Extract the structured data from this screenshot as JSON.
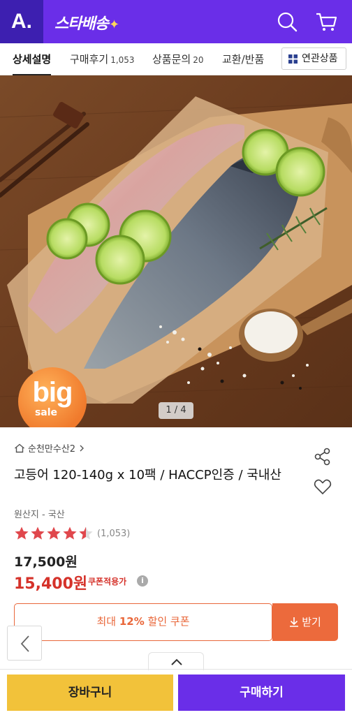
{
  "header": {
    "logo_letter": "A.",
    "brand": "스타배송",
    "brand_star": "✦",
    "colors": {
      "primary": "#6a2ee8",
      "logo_bg": "#3d1fb0"
    }
  },
  "tabs": [
    {
      "label": "상세설명",
      "count": "",
      "active": true
    },
    {
      "label": "구매후기",
      "count": "1,053",
      "active": false
    },
    {
      "label": "상품문의",
      "count": "20",
      "active": false
    },
    {
      "label": "교환/반품",
      "count": "",
      "active": false
    }
  ],
  "related_button": {
    "label": "연관상품",
    "icon": "grid-icon"
  },
  "gallery": {
    "pager": "1 / 4",
    "badge_big": "big",
    "badge_sale": "sale"
  },
  "product": {
    "store": "순천만수산2",
    "title": "고등어 120-140g x 10팩 / HACCP인증 / 국내산",
    "origin": "원산지 - 국산",
    "rating_value": 4.5,
    "rating_count": "(1,053)",
    "original_price": "17,500원",
    "sale_price": "15,400원",
    "coupon_applied_label": "쿠폰적용가",
    "info_icon": "i"
  },
  "coupon": {
    "prefix": "최대 ",
    "percent": "12%",
    "suffix": " 할인 쿠폰",
    "button": "받기",
    "color": "#e9673a"
  },
  "bottom_bar": {
    "cart": "장바구니",
    "buy": "구매하기",
    "cart_color": "#f2c23a",
    "buy_color": "#6a2ee8"
  }
}
